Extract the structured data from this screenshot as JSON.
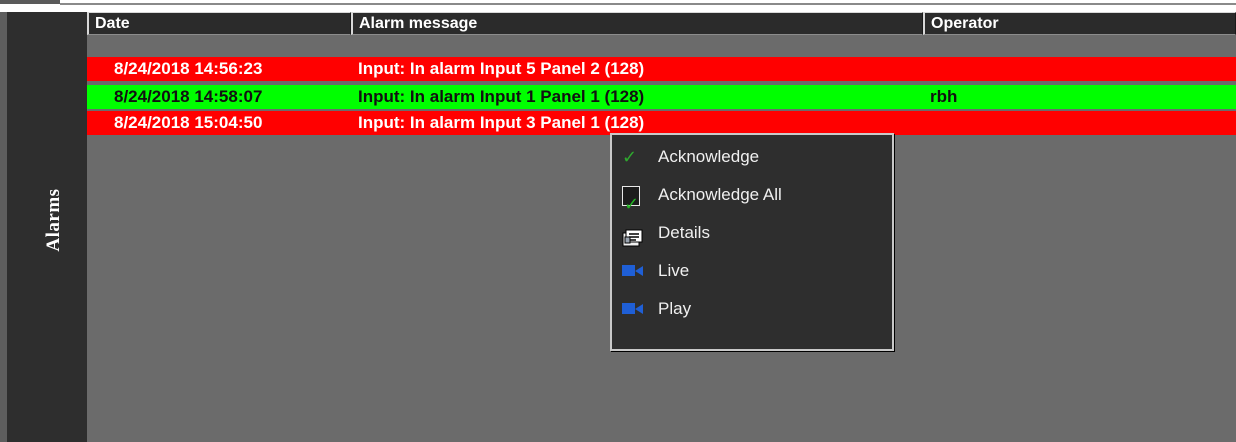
{
  "side_panel": {
    "title": "Alarms"
  },
  "table": {
    "columns": [
      "Date",
      "Alarm message",
      "Operator"
    ],
    "rows": [
      {
        "date": "8/24/2018 14:56:23",
        "message": "Input: In alarm Input 5  Panel 2 (128)",
        "operator": "",
        "status_color": "#ff0000"
      },
      {
        "date": "8/24/2018 14:58:07",
        "message": "Input: In alarm Input 1  Panel 1 (128)",
        "operator": "rbh",
        "status_color": "#00ff00"
      },
      {
        "date": "8/24/2018 15:04:50",
        "message": "Input: In alarm Input 3  Panel 1 (128)",
        "operator": "",
        "status_color": "#ff0000"
      }
    ]
  },
  "context_menu": {
    "items": [
      {
        "label": "Acknowledge",
        "icon": "check-icon"
      },
      {
        "label": "Acknowledge All",
        "icon": "checkbox-check-icon"
      },
      {
        "label": "Details",
        "icon": "details-icon"
      },
      {
        "label": "Live",
        "icon": "camera-icon"
      },
      {
        "label": "Play",
        "icon": "camera-icon"
      }
    ]
  },
  "colors": {
    "alarm_unacknowledged": "#ff0000",
    "alarm_acknowledged": "#00ff00",
    "panel_bg": "#2e2e2e",
    "grid_bg": "#6b6b6b"
  }
}
